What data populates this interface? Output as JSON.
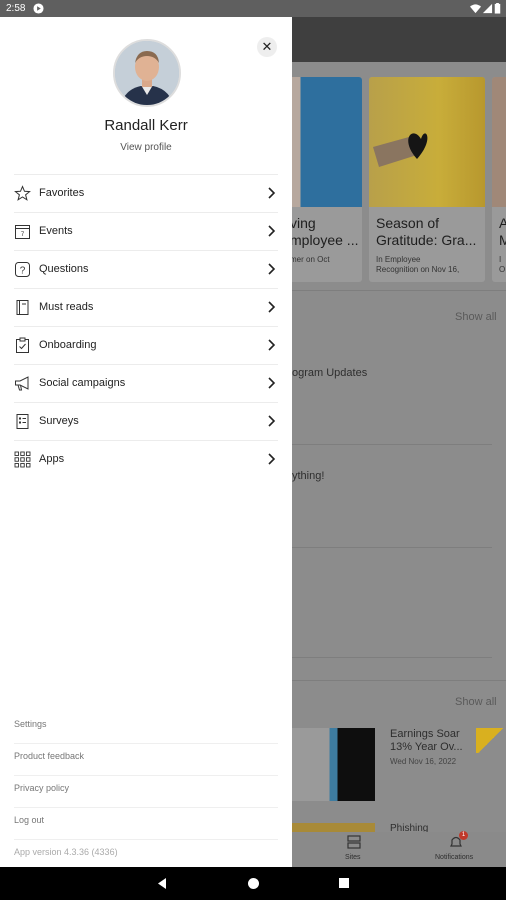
{
  "statusbar": {
    "time": "2:58"
  },
  "drawer": {
    "user_name": "Randall Kerr",
    "view_profile": "View profile",
    "menu": [
      {
        "label": "Favorites",
        "icon": "star-icon"
      },
      {
        "label": "Events",
        "icon": "calendar-icon"
      },
      {
        "label": "Questions",
        "icon": "question-icon"
      },
      {
        "label": "Must reads",
        "icon": "book-icon"
      },
      {
        "label": "Onboarding",
        "icon": "clipboard-icon"
      },
      {
        "label": "Social campaigns",
        "icon": "megaphone-icon"
      },
      {
        "label": "Surveys",
        "icon": "survey-icon"
      },
      {
        "label": "Apps",
        "icon": "apps-grid-icon"
      }
    ],
    "footer": {
      "settings": "Settings",
      "feedback": "Product feedback",
      "privacy": "Privacy policy",
      "logout": "Log out",
      "version": "App version 4.3.36 (4336)"
    }
  },
  "background": {
    "card1": {
      "title": "ving\nmployee ...",
      "meta": "mer on Oct"
    },
    "card2": {
      "title": "Season of\nGratitude: Gra...",
      "meta": "In Employee\nRecognition on Nov 16,"
    },
    "card3": {
      "title": "A\nM",
      "meta": "I\nO"
    },
    "show_all_1": "Show all",
    "program_updates": "ogram Updates",
    "anything": "ything!",
    "show_all_2": "Show all",
    "earnings_title": "Earnings Soar\n13% Year Ov...",
    "earnings_date": "Wed Nov 16, 2022",
    "phishing": "Phishing",
    "nav_sites": "Sites",
    "nav_notifications": "Notifications",
    "notification_count": "1"
  },
  "colors": {
    "accent_yellow": "#f5c518",
    "badge_red": "#c0392b"
  }
}
